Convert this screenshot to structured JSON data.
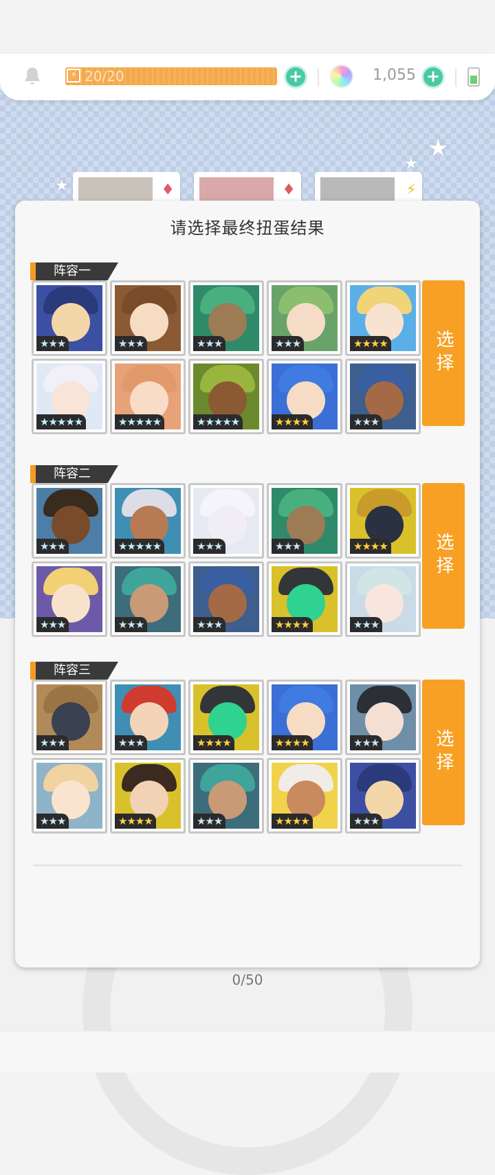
{
  "status_bar": {
    "stamina": "20/20",
    "gems": "1,055"
  },
  "dialog": {
    "title": "请选择最终扭蛋结果",
    "select_label": "选择",
    "groups": [
      {
        "label": "阵容一",
        "heroes": [
          {
            "stars": 3,
            "stars_text": "★★★",
            "palette": {
              "bg": "#3d4fa3",
              "hair": "#2b3a7a",
              "face": "#f4d7a8"
            }
          },
          {
            "stars": 3,
            "stars_text": "★★★",
            "palette": {
              "bg": "#8a5a34",
              "hair": "#7a4b28",
              "face": "#f6dcc2"
            }
          },
          {
            "stars": 3,
            "stars_text": "★★★",
            "palette": {
              "bg": "#2f8a6a",
              "hair": "#48b07f",
              "face": "#9c7b55"
            }
          },
          {
            "stars": 3,
            "stars_text": "★★★",
            "palette": {
              "bg": "#6aa36a",
              "hair": "#8bbf6f",
              "face": "#f5dcc7"
            }
          },
          {
            "stars": 4,
            "stars_text": "★★★★",
            "palette": {
              "bg": "#5ab0e6",
              "hair": "#f1d37a",
              "face": "#f8e3d0"
            }
          },
          {
            "stars": 5,
            "stars_text": "★★★★★",
            "palette": {
              "bg": "#dfe9f5",
              "hair": "#f0f0f6",
              "face": "#f8e4d8"
            }
          },
          {
            "stars": 5,
            "stars_text": "★★★★★",
            "palette": {
              "bg": "#e8a27a",
              "hair": "#e39a6a",
              "face": "#f8dcc8"
            }
          },
          {
            "stars": 5,
            "stars_text": "★★★★★",
            "palette": {
              "bg": "#6b8a2e",
              "hair": "#9ab53d",
              "face": "#8b5a33"
            }
          },
          {
            "stars": 4,
            "stars_text": "★★★★",
            "palette": {
              "bg": "#3b6fd6",
              "hair": "#3f7be0",
              "face": "#f6dcc5"
            }
          },
          {
            "stars": 3,
            "stars_text": "★★★",
            "palette": {
              "bg": "#3e5e8e",
              "hair": "#3a5fa0",
              "face": "#a46a45"
            }
          }
        ]
      },
      {
        "label": "阵容二",
        "heroes": [
          {
            "stars": 3,
            "stars_text": "★★★",
            "palette": {
              "bg": "#4d7ea8",
              "hair": "#3a2b1f",
              "face": "#7a4b2a"
            }
          },
          {
            "stars": 5,
            "stars_text": "★★★★★",
            "palette": {
              "bg": "#3f8fb5",
              "hair": "#dcdde6",
              "face": "#b87a52"
            }
          },
          {
            "stars": 3,
            "stars_text": "★★★",
            "palette": {
              "bg": "#e7e9f2",
              "hair": "#f4f4fa",
              "face": "#f0eef4"
            }
          },
          {
            "stars": 3,
            "stars_text": "★★★",
            "palette": {
              "bg": "#2f8a6a",
              "hair": "#48b07f",
              "face": "#9c7b55"
            }
          },
          {
            "stars": 4,
            "stars_text": "★★★★",
            "palette": {
              "bg": "#d8c12a",
              "hair": "#c99b2a",
              "face": "#2a3140"
            }
          },
          {
            "stars": 3,
            "stars_text": "★★★",
            "palette": {
              "bg": "#6c5aa8",
              "hair": "#f2d074",
              "face": "#f8e2cc"
            }
          },
          {
            "stars": 3,
            "stars_text": "★★★",
            "palette": {
              "bg": "#3d6c7a",
              "hair": "#3fa59a",
              "face": "#c99a76"
            }
          },
          {
            "stars": 3,
            "stars_text": "★★★",
            "palette": {
              "bg": "#3e5e8e",
              "hair": "#3a5fa0",
              "face": "#a46a45"
            }
          },
          {
            "stars": 4,
            "stars_text": "★★★★",
            "palette": {
              "bg": "#d8c12a",
              "hair": "#333638",
              "face": "#2fd28e"
            }
          },
          {
            "stars": 3,
            "stars_text": "★★★",
            "palette": {
              "bg": "#c8dbe6",
              "hair": "#cfe5e6",
              "face": "#f8e6de"
            }
          }
        ]
      },
      {
        "label": "阵容三",
        "heroes": [
          {
            "stars": 3,
            "stars_text": "★★★",
            "palette": {
              "bg": "#b28a5a",
              "hair": "#9b7446",
              "face": "#3a4150"
            }
          },
          {
            "stars": 3,
            "stars_text": "★★★",
            "palette": {
              "bg": "#3f8fb5",
              "hair": "#d13a2f",
              "face": "#f4d4b8"
            }
          },
          {
            "stars": 4,
            "stars_text": "★★★★",
            "palette": {
              "bg": "#d8c12a",
              "hair": "#333638",
              "face": "#2fd28e"
            }
          },
          {
            "stars": 4,
            "stars_text": "★★★★",
            "palette": {
              "bg": "#3b6fd6",
              "hair": "#3f7be0",
              "face": "#f6dcc5"
            }
          },
          {
            "stars": 3,
            "stars_text": "★★★",
            "palette": {
              "bg": "#6f8fa8",
              "hair": "#2b2f36",
              "face": "#f4e0d2"
            }
          },
          {
            "stars": 3,
            "stars_text": "★★★",
            "palette": {
              "bg": "#8fb3c8",
              "hair": "#f1d3a2",
              "face": "#fbe4cf"
            }
          },
          {
            "stars": 4,
            "stars_text": "★★★★",
            "palette": {
              "bg": "#d8c12a",
              "hair": "#3a2a20",
              "face": "#f2d2b4"
            }
          },
          {
            "stars": 3,
            "stars_text": "★★★",
            "palette": {
              "bg": "#3d6c7a",
              "hair": "#3fa59a",
              "face": "#c99a76"
            }
          },
          {
            "stars": 4,
            "stars_text": "★★★★",
            "palette": {
              "bg": "#f0d34a",
              "hair": "#f2ece6",
              "face": "#c98a5e"
            }
          },
          {
            "stars": 3,
            "stars_text": "★★★",
            "palette": {
              "bg": "#3d4fa3",
              "hair": "#2b3a7a",
              "face": "#f4d7a8"
            }
          }
        ]
      }
    ]
  },
  "footer": {
    "counter": "0/50"
  },
  "colors": {
    "accent": "#f7a024",
    "tag_bg": "#3a3a3a",
    "plus": "#49c9a4"
  }
}
